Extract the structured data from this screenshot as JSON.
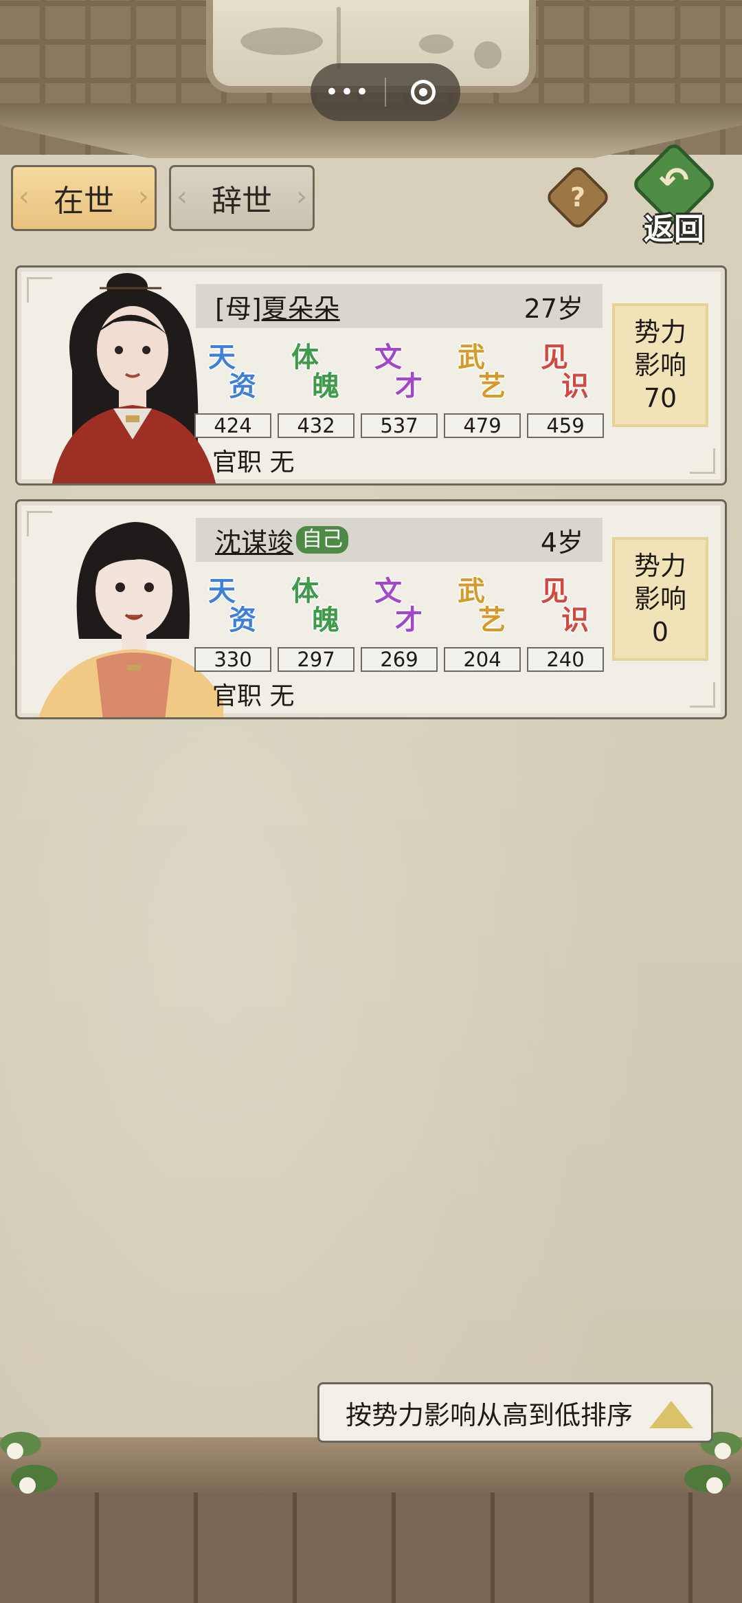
{
  "header": {
    "capsule_more": "•••"
  },
  "tabs": [
    {
      "label": "在世",
      "active": true
    },
    {
      "label": "辞世",
      "active": false
    }
  ],
  "help_label": "?",
  "back_label": "返回",
  "stat_names": [
    {
      "c1": "天",
      "c2": "资",
      "color": "#3f7fd8"
    },
    {
      "c1": "体",
      "c2": "魄",
      "color": "#3f9a4a"
    },
    {
      "c1": "文",
      "c2": "才",
      "color": "#a347c9"
    },
    {
      "c1": "武",
      "c2": "艺",
      "color": "#d79a2a"
    },
    {
      "c1": "见",
      "c2": "识",
      "color": "#d2493f"
    }
  ],
  "members": [
    {
      "name_prefix": "[母]",
      "name": "夏朵朵",
      "badge": "",
      "age": "27岁",
      "stats": [
        "424",
        "432",
        "537",
        "479",
        "459"
      ],
      "office_label": "官职",
      "office": "无",
      "influence_label_1": "势力",
      "influence_label_2": "影响",
      "influence": "70"
    },
    {
      "name_prefix": "",
      "name": "沈谋竣",
      "badge": "自己",
      "age": "4岁",
      "stats": [
        "330",
        "297",
        "269",
        "204",
        "240"
      ],
      "office_label": "官职",
      "office": "无",
      "influence_label_1": "势力",
      "influence_label_2": "影响",
      "influence": "0"
    }
  ],
  "sort_label": "按势力影响从高到低排序"
}
